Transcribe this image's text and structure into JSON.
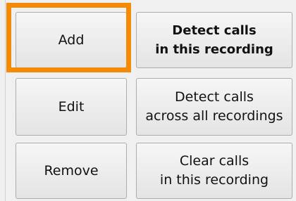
{
  "buttons": {
    "add": "Add",
    "detect_this": "Detect calls\nin this recording",
    "edit": "Edit",
    "detect_all": "Detect calls\nacross all recordings",
    "remove": "Remove",
    "clear_this": "Clear calls\nin this recording"
  },
  "highlight_color": "#f58a07"
}
